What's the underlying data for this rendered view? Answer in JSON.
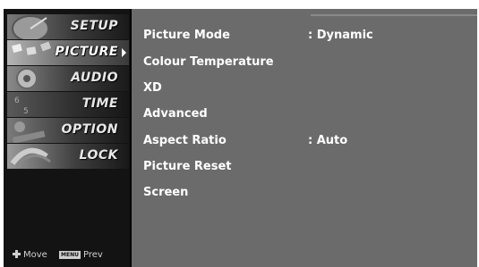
{
  "menu": {
    "categories": [
      {
        "label": "SETUP",
        "icon": "satellite-dish-icon"
      },
      {
        "label": "PICTURE",
        "icon": "picture-icon",
        "selected": true
      },
      {
        "label": "AUDIO",
        "icon": "speaker-icon"
      },
      {
        "label": "TIME",
        "icon": "clock-icon"
      },
      {
        "label": "OPTION",
        "icon": "option-icon"
      },
      {
        "label": "LOCK",
        "icon": "lock-icon"
      }
    ],
    "footer": {
      "move_label": "Move",
      "menu_key_label": "MENU",
      "prev_label": "Prev"
    }
  },
  "picture_menu": {
    "items": [
      {
        "label": "Picture Mode",
        "value": ": Dynamic"
      },
      {
        "label": "Colour Temperature",
        "value": ""
      },
      {
        "label": "XD",
        "value": ""
      },
      {
        "label": "Advanced",
        "value": ""
      },
      {
        "label": "Aspect Ratio",
        "value": ": Auto"
      },
      {
        "label": "Picture Reset",
        "value": ""
      },
      {
        "label": "Screen",
        "value": ""
      }
    ]
  },
  "colors": {
    "panel_background": "#6b6b6b",
    "sidebar_background": "#131313",
    "text": "#ffffff"
  }
}
